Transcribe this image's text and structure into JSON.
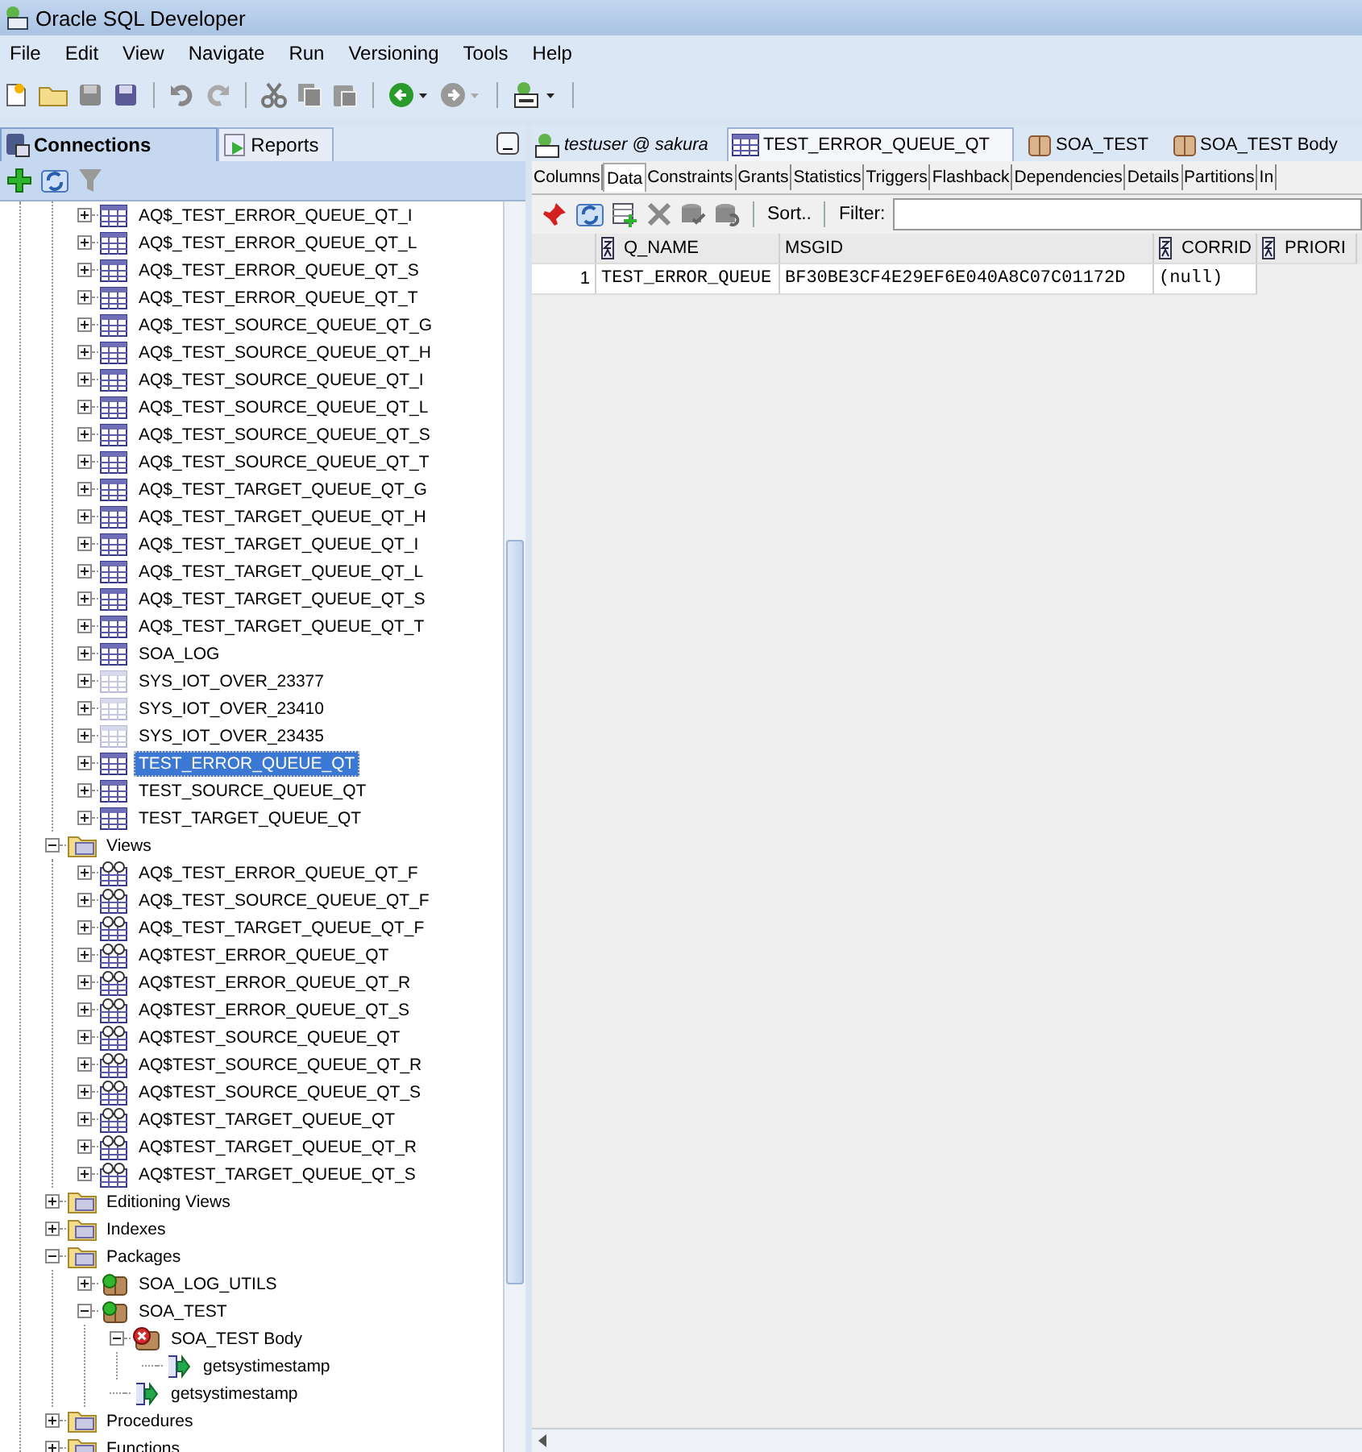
{
  "window": {
    "title": "Oracle SQL Developer"
  },
  "menu": [
    "File",
    "Edit",
    "View",
    "Navigate",
    "Run",
    "Versioning",
    "Tools",
    "Help"
  ],
  "left_tabs": [
    {
      "label": "Connections",
      "selected": true
    },
    {
      "label": "Reports",
      "selected": false
    }
  ],
  "tables_tail": [
    {
      "label": "AQ$_TEST_ERROR_QUEUE_QT_I",
      "kind": "table",
      "expanded": false,
      "selected": false
    },
    {
      "label": "AQ$_TEST_ERROR_QUEUE_QT_L",
      "kind": "table",
      "expanded": false,
      "selected": false
    },
    {
      "label": "AQ$_TEST_ERROR_QUEUE_QT_S",
      "kind": "table",
      "expanded": false,
      "selected": false
    },
    {
      "label": "AQ$_TEST_ERROR_QUEUE_QT_T",
      "kind": "table",
      "expanded": false,
      "selected": false
    },
    {
      "label": "AQ$_TEST_SOURCE_QUEUE_QT_G",
      "kind": "table",
      "expanded": false,
      "selected": false
    },
    {
      "label": "AQ$_TEST_SOURCE_QUEUE_QT_H",
      "kind": "table",
      "expanded": false,
      "selected": false
    },
    {
      "label": "AQ$_TEST_SOURCE_QUEUE_QT_I",
      "kind": "table",
      "expanded": false,
      "selected": false
    },
    {
      "label": "AQ$_TEST_SOURCE_QUEUE_QT_L",
      "kind": "table",
      "expanded": false,
      "selected": false
    },
    {
      "label": "AQ$_TEST_SOURCE_QUEUE_QT_S",
      "kind": "table",
      "expanded": false,
      "selected": false
    },
    {
      "label": "AQ$_TEST_SOURCE_QUEUE_QT_T",
      "kind": "table",
      "expanded": false,
      "selected": false
    },
    {
      "label": "AQ$_TEST_TARGET_QUEUE_QT_G",
      "kind": "table",
      "expanded": false,
      "selected": false
    },
    {
      "label": "AQ$_TEST_TARGET_QUEUE_QT_H",
      "kind": "table",
      "expanded": false,
      "selected": false
    },
    {
      "label": "AQ$_TEST_TARGET_QUEUE_QT_I",
      "kind": "table",
      "expanded": false,
      "selected": false
    },
    {
      "label": "AQ$_TEST_TARGET_QUEUE_QT_L",
      "kind": "table",
      "expanded": false,
      "selected": false
    },
    {
      "label": "AQ$_TEST_TARGET_QUEUE_QT_S",
      "kind": "table",
      "expanded": false,
      "selected": false
    },
    {
      "label": "AQ$_TEST_TARGET_QUEUE_QT_T",
      "kind": "table",
      "expanded": false,
      "selected": false
    },
    {
      "label": "SOA_LOG",
      "kind": "table",
      "expanded": false,
      "selected": false
    },
    {
      "label": "SYS_IOT_OVER_23377",
      "kind": "table-sys",
      "expanded": false,
      "selected": false
    },
    {
      "label": "SYS_IOT_OVER_23410",
      "kind": "table-sys",
      "expanded": false,
      "selected": false
    },
    {
      "label": "SYS_IOT_OVER_23435",
      "kind": "table-sys",
      "expanded": false,
      "selected": false
    },
    {
      "label": "TEST_ERROR_QUEUE_QT",
      "kind": "table",
      "expanded": false,
      "selected": true
    },
    {
      "label": "TEST_SOURCE_QUEUE_QT",
      "kind": "table",
      "expanded": false,
      "selected": false
    },
    {
      "label": "TEST_TARGET_QUEUE_QT",
      "kind": "table",
      "expanded": false,
      "selected": false
    }
  ],
  "tree": [
    {
      "label": "Views",
      "kind": "folder",
      "expanded": true,
      "selected": false,
      "children": [
        {
          "label": "AQ$_TEST_ERROR_QUEUE_QT_F",
          "kind": "view",
          "expanded": false,
          "selected": false
        },
        {
          "label": "AQ$_TEST_SOURCE_QUEUE_QT_F",
          "kind": "view",
          "expanded": false,
          "selected": false
        },
        {
          "label": "AQ$_TEST_TARGET_QUEUE_QT_F",
          "kind": "view",
          "expanded": false,
          "selected": false
        },
        {
          "label": "AQ$TEST_ERROR_QUEUE_QT",
          "kind": "view",
          "expanded": false,
          "selected": false
        },
        {
          "label": "AQ$TEST_ERROR_QUEUE_QT_R",
          "kind": "view",
          "expanded": false,
          "selected": false
        },
        {
          "label": "AQ$TEST_ERROR_QUEUE_QT_S",
          "kind": "view",
          "expanded": false,
          "selected": false
        },
        {
          "label": "AQ$TEST_SOURCE_QUEUE_QT",
          "kind": "view",
          "expanded": false,
          "selected": false
        },
        {
          "label": "AQ$TEST_SOURCE_QUEUE_QT_R",
          "kind": "view",
          "expanded": false,
          "selected": false
        },
        {
          "label": "AQ$TEST_SOURCE_QUEUE_QT_S",
          "kind": "view",
          "expanded": false,
          "selected": false
        },
        {
          "label": "AQ$TEST_TARGET_QUEUE_QT",
          "kind": "view",
          "expanded": false,
          "selected": false
        },
        {
          "label": "AQ$TEST_TARGET_QUEUE_QT_R",
          "kind": "view",
          "expanded": false,
          "selected": false
        },
        {
          "label": "AQ$TEST_TARGET_QUEUE_QT_S",
          "kind": "view",
          "expanded": false,
          "selected": false
        }
      ]
    },
    {
      "label": "Editioning Views",
      "kind": "folder",
      "expanded": false,
      "selected": false
    },
    {
      "label": "Indexes",
      "kind": "folder",
      "expanded": false,
      "selected": false
    },
    {
      "label": "Packages",
      "kind": "folder",
      "expanded": true,
      "selected": false,
      "children": [
        {
          "label": "SOA_LOG_UTILS",
          "kind": "package",
          "expanded": false,
          "selected": false
        },
        {
          "label": "SOA_TEST",
          "kind": "package",
          "expanded": true,
          "selected": false,
          "children": [
            {
              "label": "SOA_TEST Body",
              "kind": "package-error",
              "expanded": true,
              "selected": false,
              "children": [
                {
                  "label": "getsystimestamp",
                  "kind": "procedure",
                  "selected": false
                }
              ]
            },
            {
              "label": "getsystimestamp",
              "kind": "procedure",
              "selected": false
            }
          ]
        }
      ]
    },
    {
      "label": "Procedures",
      "kind": "folder",
      "expanded": false,
      "selected": false
    },
    {
      "label": "Functions",
      "kind": "folder",
      "expanded": false,
      "selected": false
    }
  ],
  "editor_tabs": [
    {
      "label": "testuser @ sakura",
      "kind": "sql",
      "selected": false
    },
    {
      "label": "TEST_ERROR_QUEUE_QT",
      "kind": "table",
      "selected": true
    },
    {
      "label": "SOA_TEST",
      "kind": "package",
      "selected": false
    },
    {
      "label": "SOA_TEST Body",
      "kind": "package",
      "selected": false
    }
  ],
  "sub_tabs": [
    {
      "label": "Columns",
      "selected": false
    },
    {
      "label": "Data",
      "selected": true
    },
    {
      "label": "Constraints",
      "selected": false
    },
    {
      "label": "Grants",
      "selected": false
    },
    {
      "label": "Statistics",
      "selected": false
    },
    {
      "label": "Triggers",
      "selected": false
    },
    {
      "label": "Flashback",
      "selected": false
    },
    {
      "label": "Dependencies",
      "selected": false
    },
    {
      "label": "Details",
      "selected": false
    },
    {
      "label": "Partitions",
      "selected": false
    },
    {
      "label": "In",
      "selected": false
    }
  ],
  "data_toolbar": {
    "sort": "Sort..",
    "filter_label": "Filter:"
  },
  "grid": {
    "columns": [
      {
        "label": "Q_NAME",
        "sortable": true
      },
      {
        "label": "MSGID",
        "sortable": false
      },
      {
        "label": "CORRID",
        "sortable": true
      },
      {
        "label": "PRIORI",
        "sortable": true
      }
    ],
    "rows": [
      {
        "number": "1",
        "cells": [
          "TEST_ERROR_QUEUE",
          "BF30BE3CF4E29EF6E040A8C07C01172D",
          "(null)"
        ]
      }
    ]
  }
}
